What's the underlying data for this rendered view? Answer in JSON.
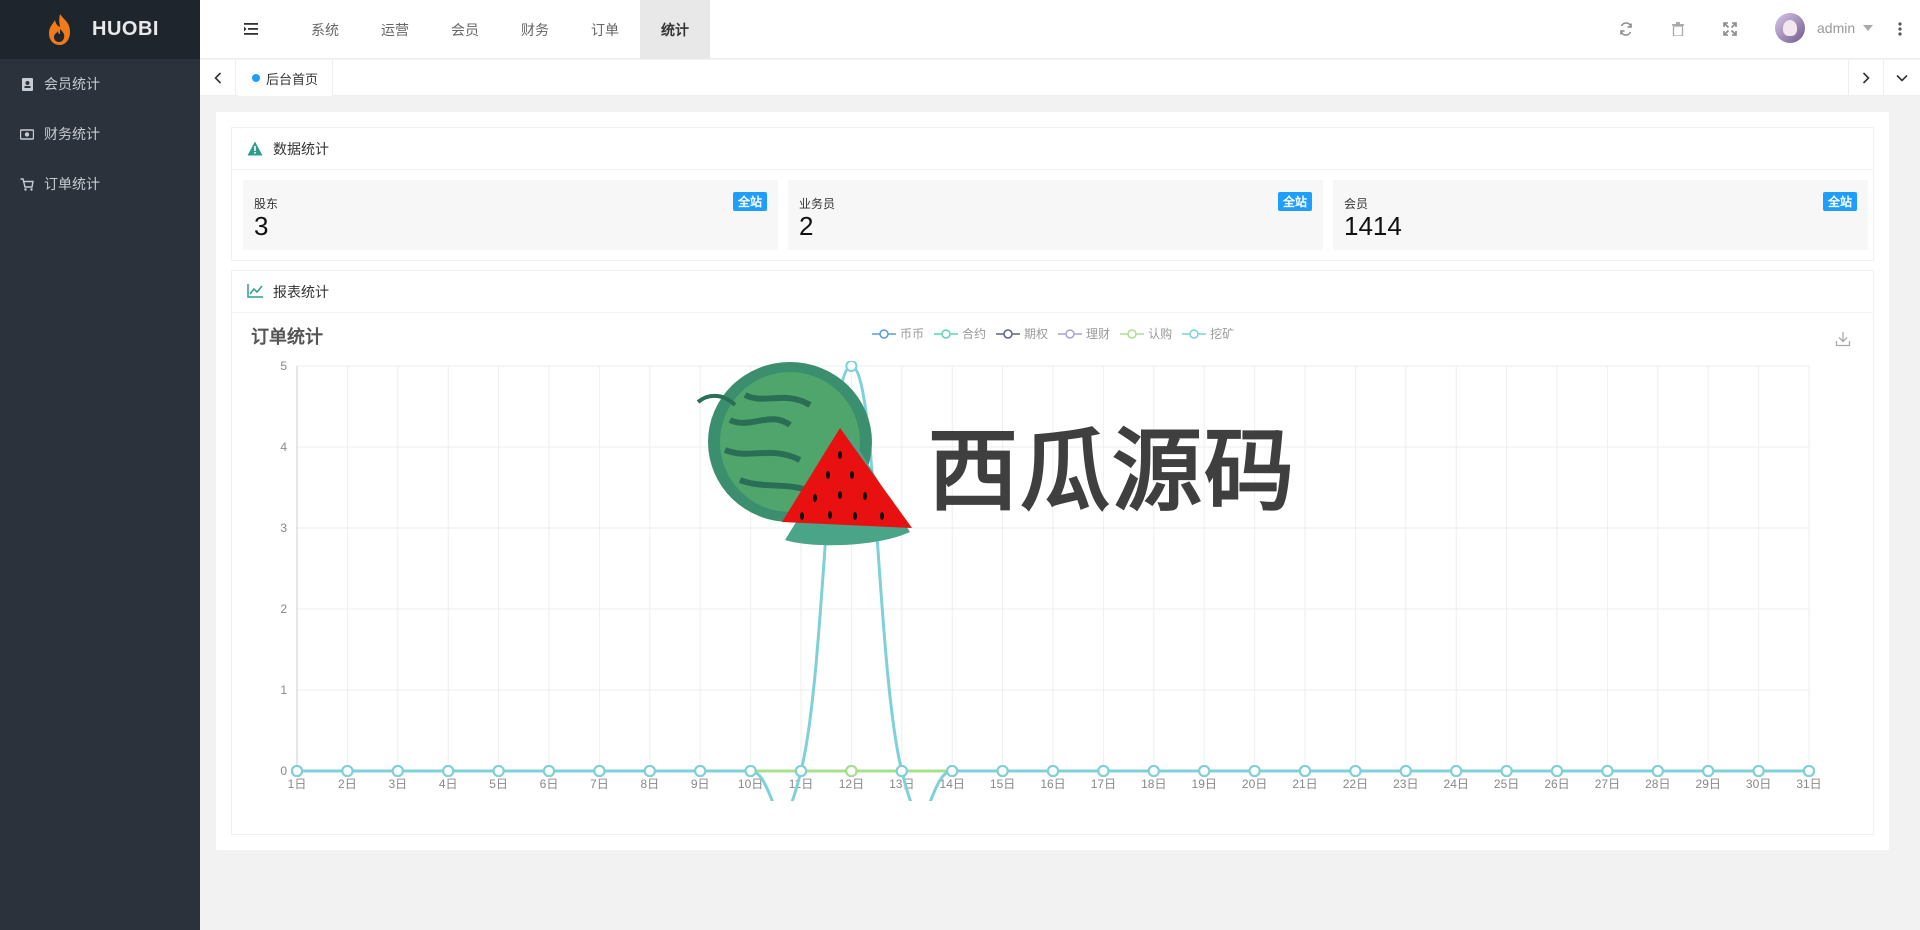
{
  "brand": {
    "name": "HUOBI"
  },
  "sidebar": {
    "items": [
      {
        "label": "会员统计",
        "icon": "member-book-icon"
      },
      {
        "label": "财务统计",
        "icon": "money-icon"
      },
      {
        "label": "订单统计",
        "icon": "cart-icon"
      }
    ]
  },
  "header": {
    "nav": [
      "系统",
      "运营",
      "会员",
      "财务",
      "订单",
      "统计"
    ],
    "active_nav": "统计",
    "user": "admin"
  },
  "tabs": {
    "items": [
      "后台首页"
    ]
  },
  "stats_panel": {
    "title": "数据统计",
    "cards": [
      {
        "label": "股东",
        "value": "3",
        "badge": "全站"
      },
      {
        "label": "业务员",
        "value": "2",
        "badge": "全站"
      },
      {
        "label": "会员",
        "value": "1414",
        "badge": "全站"
      }
    ]
  },
  "report_panel": {
    "title": "报表统计"
  },
  "watermark": {
    "text": "西瓜源码"
  },
  "colors": {
    "accent": "#1e9fff",
    "sidebar": "#2b323b",
    "logo_bg": "#1f252c",
    "series_main": "#7fd1d9"
  },
  "chart_data": {
    "type": "line",
    "title": "订单统计",
    "x": [
      "1日",
      "2日",
      "3日",
      "4日",
      "5日",
      "6日",
      "7日",
      "8日",
      "9日",
      "10日",
      "11日",
      "12日",
      "13日",
      "14日",
      "15日",
      "16日",
      "17日",
      "18日",
      "19日",
      "20日",
      "21日",
      "22日",
      "23日",
      "24日",
      "25日",
      "26日",
      "27日",
      "28日",
      "29日",
      "30日",
      "31日"
    ],
    "ylim": [
      0,
      5
    ],
    "yticks": [
      0,
      1,
      2,
      3,
      4,
      5
    ],
    "grid": true,
    "legend_position": "top-center",
    "series": [
      {
        "name": "币币",
        "color": "#5b9bd5",
        "values": [
          0,
          0,
          0,
          0,
          0,
          0,
          0,
          0,
          0,
          0,
          0,
          0,
          0,
          0,
          0,
          0,
          0,
          0,
          0,
          0,
          0,
          0,
          0,
          0,
          0,
          0,
          0,
          0,
          0,
          0,
          0
        ]
      },
      {
        "name": "合约",
        "color": "#5fd3b9",
        "values": [
          0,
          0,
          0,
          0,
          0,
          0,
          0,
          0,
          0,
          0,
          0,
          0,
          0,
          0,
          0,
          0,
          0,
          0,
          0,
          0,
          0,
          0,
          0,
          0,
          0,
          0,
          0,
          0,
          0,
          0,
          0
        ]
      },
      {
        "name": "期权",
        "color": "#5c6380",
        "values": [
          0,
          0,
          0,
          0,
          0,
          0,
          0,
          0,
          0,
          0,
          0,
          0,
          0,
          0,
          0,
          0,
          0,
          0,
          0,
          0,
          0,
          0,
          0,
          0,
          0,
          0,
          0,
          0,
          0,
          0,
          0
        ]
      },
      {
        "name": "理财",
        "color": "#a7a3d8",
        "values": [
          0,
          0,
          0,
          0,
          0,
          0,
          0,
          0,
          0,
          0,
          0,
          0,
          0,
          0,
          0,
          0,
          0,
          0,
          0,
          0,
          0,
          0,
          0,
          0,
          0,
          0,
          0,
          0,
          0,
          0,
          0
        ]
      },
      {
        "name": "认购",
        "color": "#a9e08f",
        "values": [
          0,
          0,
          0,
          0,
          0,
          0,
          0,
          0,
          0,
          0,
          0,
          0,
          0,
          0,
          0,
          0,
          0,
          0,
          0,
          0,
          0,
          0,
          0,
          0,
          0,
          0,
          0,
          0,
          0,
          0,
          0
        ]
      },
      {
        "name": "挖矿",
        "color": "#7fd1d9",
        "values": [
          0,
          0,
          0,
          0,
          0,
          0,
          0,
          0,
          0,
          0,
          0,
          5,
          0,
          0,
          0,
          0,
          0,
          0,
          0,
          0,
          0,
          0,
          0,
          0,
          0,
          0,
          0,
          0,
          0,
          0,
          0
        ]
      }
    ]
  }
}
